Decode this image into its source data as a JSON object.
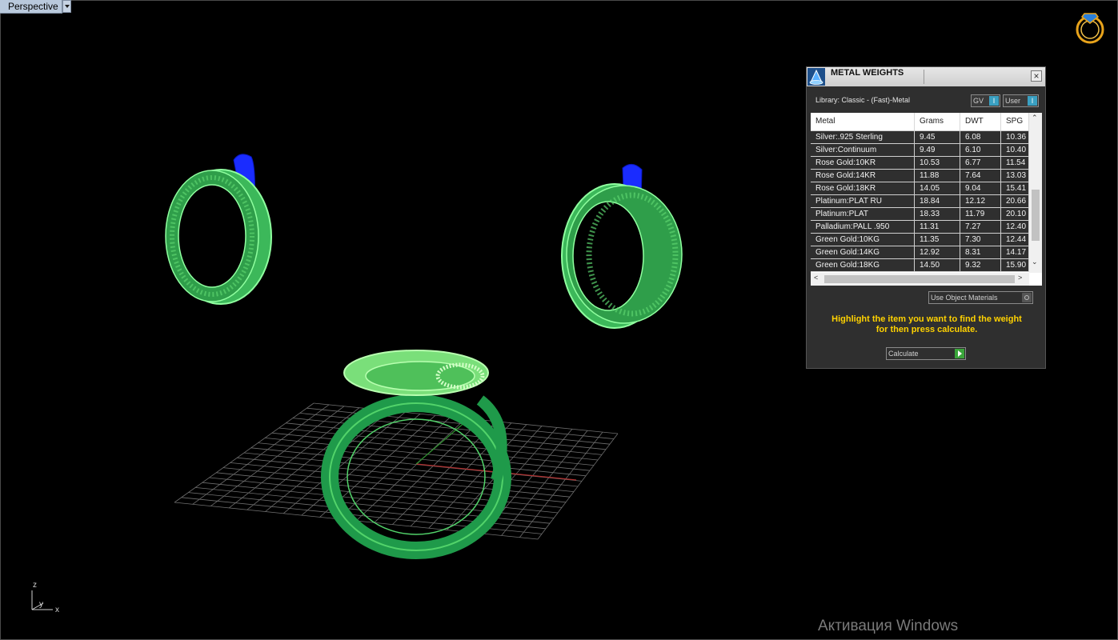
{
  "viewport": {
    "name": "Perspective",
    "axis_z": "z",
    "axis_y": "y",
    "axis_x": "x"
  },
  "colors": {
    "model_green": "#52d36a",
    "model_dark_green": "#1f9a4a",
    "selected_blue": "#1a2cff",
    "grid": "#6e6e6e",
    "panel_bg": "#2f2f2f",
    "hint_yellow": "#ffd200",
    "logo_gold": "#e8a31b"
  },
  "logo": {
    "icon": "ring-logo-icon"
  },
  "panel": {
    "title": "METAL WEIGHTS",
    "title_icon": "metal-weights-icon",
    "close_label": "×",
    "library_text": "Library: Classic - (Fast)-Metal",
    "toggle_gv": "GV",
    "toggle_user": "User",
    "toggle_glyph": "I",
    "columns": [
      "Metal",
      "Grams",
      "DWT",
      "SPG"
    ],
    "rows": [
      {
        "metal": "Silver:.925 Sterling",
        "grams": "9.45",
        "dwt": "6.08",
        "spg": "10.36"
      },
      {
        "metal": "Silver:Continuum",
        "grams": "9.49",
        "dwt": "6.10",
        "spg": "10.40"
      },
      {
        "metal": "Rose Gold:10KR",
        "grams": "10.53",
        "dwt": "6.77",
        "spg": "11.54"
      },
      {
        "metal": "Rose Gold:14KR",
        "grams": "11.88",
        "dwt": "7.64",
        "spg": "13.03"
      },
      {
        "metal": "Rose Gold:18KR",
        "grams": "14.05",
        "dwt": "9.04",
        "spg": "15.41"
      },
      {
        "metal": "Platinum:PLAT RU",
        "grams": "18.84",
        "dwt": "12.12",
        "spg": "20.66"
      },
      {
        "metal": "Platinum:PLAT",
        "grams": "18.33",
        "dwt": "11.79",
        "spg": "20.10"
      },
      {
        "metal": "Palladium:PALL .950",
        "grams": "11.31",
        "dwt": "7.27",
        "spg": "12.40"
      },
      {
        "metal": "Green Gold:10KG",
        "grams": "11.35",
        "dwt": "7.30",
        "spg": "12.44"
      },
      {
        "metal": "Green Gold:14KG",
        "grams": "12.92",
        "dwt": "8.31",
        "spg": "14.17"
      },
      {
        "metal": "Green Gold:18KG",
        "grams": "14.50",
        "dwt": "9.32",
        "spg": "15.90"
      }
    ],
    "scroll_up": "⌃",
    "scroll_down": "⌄",
    "scroll_left": "<",
    "scroll_right": ">",
    "use_object_materials": "Use Object Materials",
    "hint_line1": "Highlight the item you want to find the weight",
    "hint_line2": "for then press calculate.",
    "calculate_label": "Calculate"
  },
  "watermark": "Активация Windows"
}
